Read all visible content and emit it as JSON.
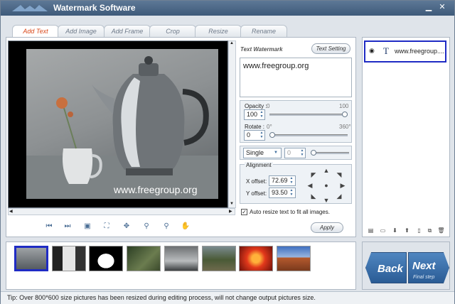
{
  "window": {
    "title": "Watermark Software"
  },
  "tabs": [
    "Add Text",
    "Add Image",
    "Add Frame",
    "Crop",
    "Resize",
    "Rename"
  ],
  "active_tab": 0,
  "preview": {
    "watermark_text": "www.freegroup.org"
  },
  "text_panel": {
    "heading": "Text Watermark",
    "setting_button": "Text Setting",
    "text_value": "www.freegroup.org"
  },
  "opacity": {
    "label": "Opacity :",
    "min": "0",
    "max": "100",
    "value": "100",
    "level": 1.0
  },
  "rotate": {
    "label": "Rotate :",
    "min": "0°",
    "max": "360°",
    "value": "0",
    "level": 0.0
  },
  "mode": {
    "select_value": "Single",
    "spin_value": "0",
    "level": 0.0
  },
  "alignment": {
    "heading": "Alignment",
    "x_label": "X offset:",
    "x_value": "72.69",
    "y_label": "Y offset:",
    "y_value": "93.50"
  },
  "apply_button": "Apply",
  "auto_resize": {
    "label": "Auto resize text to fit all images.",
    "checked": true
  },
  "layers": [
    {
      "icon": "T",
      "label": "www.freegroup...."
    }
  ],
  "nav": {
    "back": "Back",
    "next": "Next",
    "next_sub": "Final step"
  },
  "status": "Tip: Over 800*600 size pictures has been resized during editing process, will not change output pictures size.",
  "colors": {
    "accent_tab": "#d9481a",
    "selection": "#1f2bc4",
    "nav_button": "#2f67a5"
  }
}
